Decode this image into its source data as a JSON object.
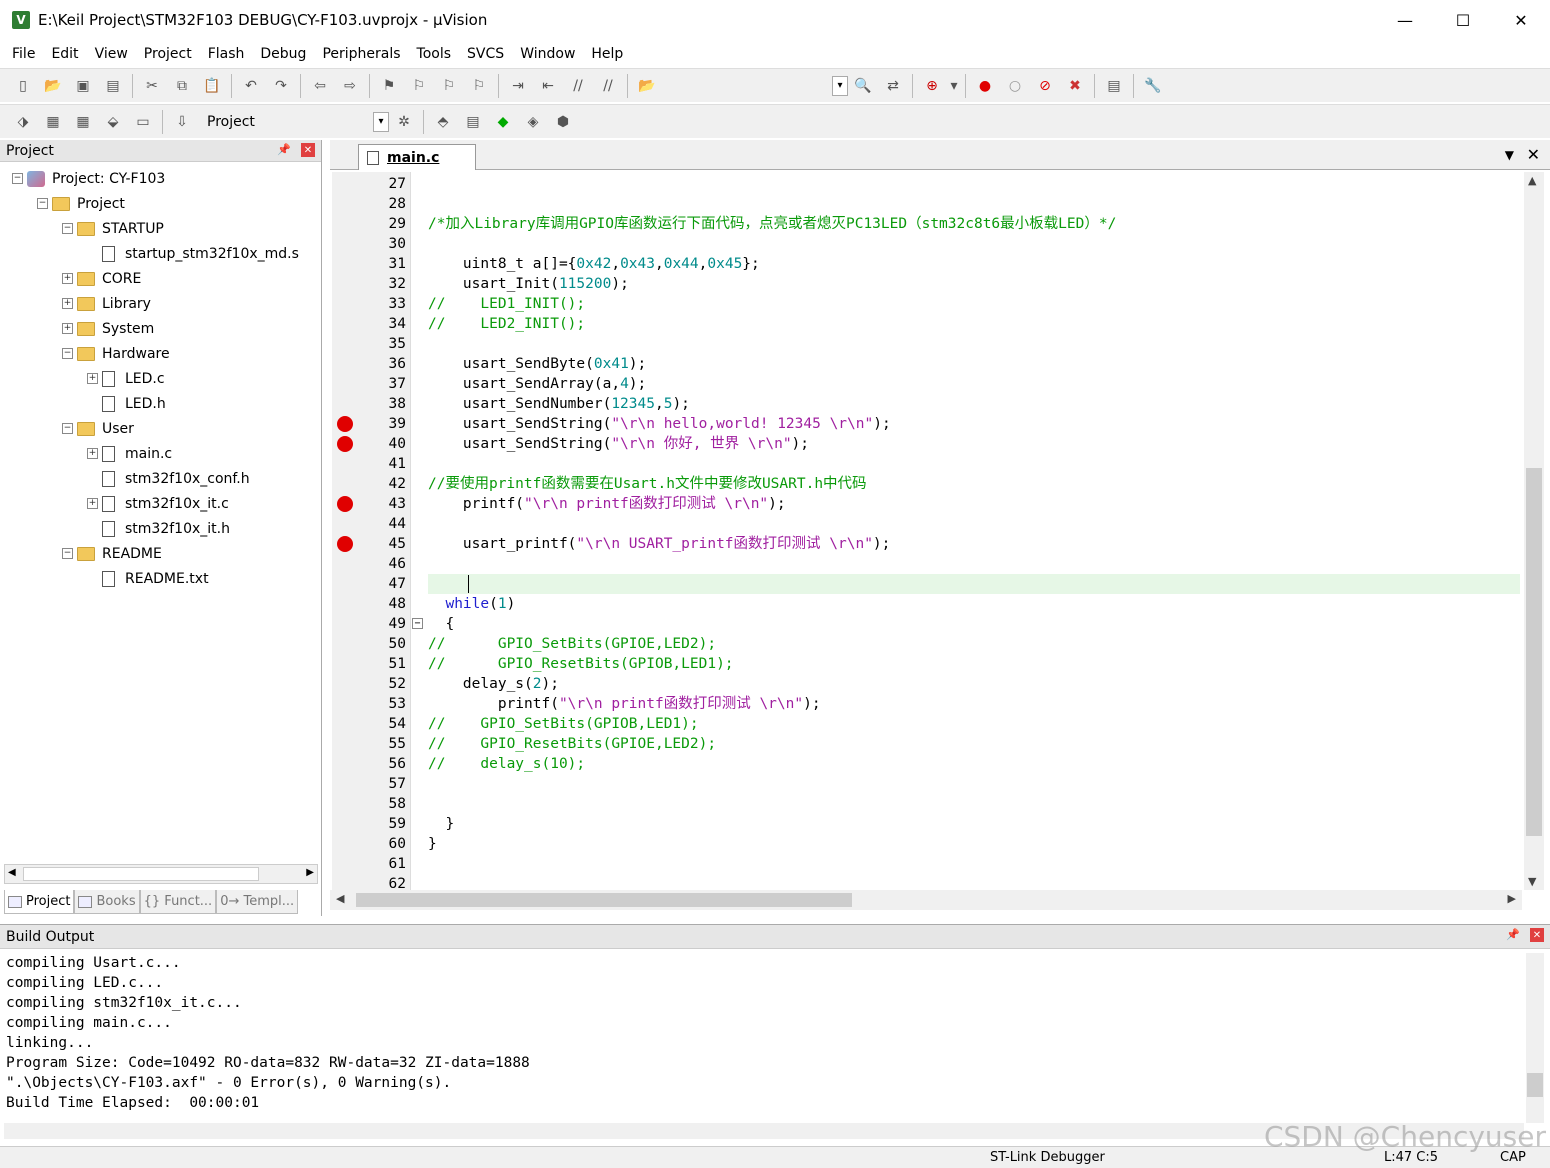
{
  "window": {
    "title": "E:\\Keil Project\\STM32F103 DEBUG\\CY-F103.uvprojx - µVision",
    "minimize": "—",
    "maximize": "☐",
    "close": "✕"
  },
  "menu": [
    "File",
    "Edit",
    "View",
    "Project",
    "Flash",
    "Debug",
    "Peripherals",
    "Tools",
    "SVCS",
    "Window",
    "Help"
  ],
  "toolbar": {
    "target": "Project"
  },
  "project_panel": {
    "title": "Project",
    "tree": [
      {
        "label": "Project: CY-F103",
        "level": 0,
        "icon": "project",
        "exp": "-"
      },
      {
        "label": "Project",
        "level": 1,
        "icon": "folder",
        "exp": "-"
      },
      {
        "label": "STARTUP",
        "level": 2,
        "icon": "folder",
        "exp": "-"
      },
      {
        "label": "startup_stm32f10x_md.s",
        "level": 3,
        "icon": "file",
        "exp": ""
      },
      {
        "label": "CORE",
        "level": 2,
        "icon": "folder",
        "exp": "+"
      },
      {
        "label": "Library",
        "level": 2,
        "icon": "folder",
        "exp": "+"
      },
      {
        "label": "System",
        "level": 2,
        "icon": "folder",
        "exp": "+"
      },
      {
        "label": "Hardware",
        "level": 2,
        "icon": "folder",
        "exp": "-"
      },
      {
        "label": "LED.c",
        "level": 3,
        "icon": "file",
        "exp": "+"
      },
      {
        "label": "LED.h",
        "level": 3,
        "icon": "file",
        "exp": ""
      },
      {
        "label": "User",
        "level": 2,
        "icon": "folder",
        "exp": "-"
      },
      {
        "label": "main.c",
        "level": 3,
        "icon": "file",
        "exp": "+"
      },
      {
        "label": "stm32f10x_conf.h",
        "level": 3,
        "icon": "file",
        "exp": ""
      },
      {
        "label": "stm32f10x_it.c",
        "level": 3,
        "icon": "file",
        "exp": "+"
      },
      {
        "label": "stm32f10x_it.h",
        "level": 3,
        "icon": "file",
        "exp": ""
      },
      {
        "label": "README",
        "level": 2,
        "icon": "folder",
        "exp": "-"
      },
      {
        "label": "README.txt",
        "level": 3,
        "icon": "file",
        "exp": ""
      }
    ],
    "tabs": [
      "Project",
      "Books",
      "{} Funct...",
      "0→ Templ..."
    ]
  },
  "editor": {
    "tab": "main.c",
    "lines": [
      {
        "n": "27",
        "text": "",
        "style": ""
      },
      {
        "n": "28",
        "text": "",
        "style": ""
      },
      {
        "n": "29",
        "text": "/*加入Library库调用GPIO库函数运行下面代码，点亮或者熄灭PC13LED（stm32c8t6最小板载LED）*/",
        "style": "green"
      },
      {
        "n": "30",
        "text": "",
        "style": ""
      },
      {
        "n": "31",
        "text": "    uint8_t a[]={0x42,0x43,0x44,0x45};",
        "style": ""
      },
      {
        "n": "32",
        "text": "    usart_Init(115200);",
        "style": ""
      },
      {
        "n": "33",
        "text": "//    LED1_INIT();",
        "style": "green"
      },
      {
        "n": "34",
        "text": "//    LED2_INIT();",
        "style": "green"
      },
      {
        "n": "35",
        "text": "",
        "style": ""
      },
      {
        "n": "36",
        "text": "    usart_SendByte(0x41);",
        "style": ""
      },
      {
        "n": "37",
        "text": "    usart_SendArray(a,4);",
        "style": ""
      },
      {
        "n": "38",
        "text": "    usart_SendNumber(12345,5);",
        "style": ""
      },
      {
        "n": "39",
        "text": "    usart_SendString(\"\\r\\n hello,world! 12345 \\r\\n\");",
        "style": "",
        "bp": true
      },
      {
        "n": "40",
        "text": "    usart_SendString(\"\\r\\n 你好, 世界 \\r\\n\");",
        "style": "",
        "bp": true
      },
      {
        "n": "41",
        "text": "",
        "style": ""
      },
      {
        "n": "42",
        "text": "//要使用printf函数需要在Usart.h文件中要修改USART.h中代码",
        "style": "green"
      },
      {
        "n": "43",
        "text": "    printf(\"\\r\\n printf函数打印测试 \\r\\n\");",
        "style": "",
        "bp": true
      },
      {
        "n": "44",
        "text": "",
        "style": ""
      },
      {
        "n": "45",
        "text": "    usart_printf(\"\\r\\n USART_printf函数打印测试 \\r\\n\");",
        "style": "",
        "bp": true
      },
      {
        "n": "46",
        "text": "",
        "style": ""
      },
      {
        "n": "47",
        "text": "",
        "style": "",
        "current": true
      },
      {
        "n": "48",
        "text": "  while(1)",
        "style": "",
        "kw": true
      },
      {
        "n": "49",
        "text": "  {",
        "style": "",
        "fold": true
      },
      {
        "n": "50",
        "text": "//      GPIO_SetBits(GPIOE,LED2);",
        "style": "green"
      },
      {
        "n": "51",
        "text": "//      GPIO_ResetBits(GPIOB,LED1);",
        "style": "green"
      },
      {
        "n": "52",
        "text": "    delay_s(2);",
        "style": ""
      },
      {
        "n": "53",
        "text": "        printf(\"\\r\\n printf函数打印测试 \\r\\n\");",
        "style": ""
      },
      {
        "n": "54",
        "text": "//    GPIO_SetBits(GPIOB,LED1);",
        "style": "green"
      },
      {
        "n": "55",
        "text": "//    GPIO_ResetBits(GPIOE,LED2);",
        "style": "green"
      },
      {
        "n": "56",
        "text": "//    delay_s(10);",
        "style": "green"
      },
      {
        "n": "57",
        "text": "",
        "style": ""
      },
      {
        "n": "58",
        "text": "",
        "style": ""
      },
      {
        "n": "59",
        "text": "  }",
        "style": ""
      },
      {
        "n": "60",
        "text": "}",
        "style": ""
      },
      {
        "n": "61",
        "text": "",
        "style": ""
      },
      {
        "n": "62",
        "text": "",
        "style": ""
      }
    ]
  },
  "build_output": {
    "title": "Build Output",
    "text": "compiling Usart.c...\ncompiling LED.c...\ncompiling stm32f10x_it.c...\ncompiling main.c...\nlinking...\nProgram Size: Code=10492 RO-data=832 RW-data=32 ZI-data=1888\n\".\\Objects\\CY-F103.axf\" - 0 Error(s), 0 Warning(s).\nBuild Time Elapsed:  00:00:01"
  },
  "status": {
    "debugger": "ST-Link Debugger",
    "position": "L:47 C:5",
    "caps": "CAP"
  },
  "watermark": "CSDN @Chencyuser",
  "colors": {
    "comment": "#0a9a0a",
    "string": "#a020a0",
    "number": "#008b8b",
    "keyword": "#1f1fcf",
    "breakpoint": "#e00000",
    "current_line": "#e6f7e6"
  }
}
